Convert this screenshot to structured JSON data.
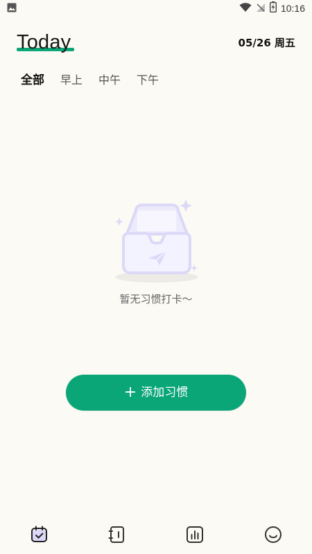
{
  "status_bar": {
    "time": "10:16",
    "icons": [
      "image-icon",
      "wifi-icon",
      "no-signal-icon",
      "battery-charging-icon"
    ]
  },
  "header": {
    "title": "Today",
    "date": "05/26 周五"
  },
  "tabs": [
    {
      "label": "全部",
      "active": true
    },
    {
      "label": "早上",
      "active": false
    },
    {
      "label": "中午",
      "active": false
    },
    {
      "label": "下午",
      "active": false
    }
  ],
  "empty_state": {
    "icon": "empty-box-icon",
    "message": "暂无习惯打卡～"
  },
  "add_button": {
    "plus": "+",
    "label": "添加习惯"
  },
  "bottom_nav": {
    "items": [
      {
        "icon": "calendar-check-icon",
        "active": true
      },
      {
        "icon": "notebook-icon",
        "active": false
      },
      {
        "icon": "stats-icon",
        "active": false
      },
      {
        "icon": "smile-icon",
        "active": false
      }
    ]
  },
  "colors": {
    "accent": "#0aa678",
    "background": "#fbfaf4",
    "illustration": "#dcd8f7"
  }
}
